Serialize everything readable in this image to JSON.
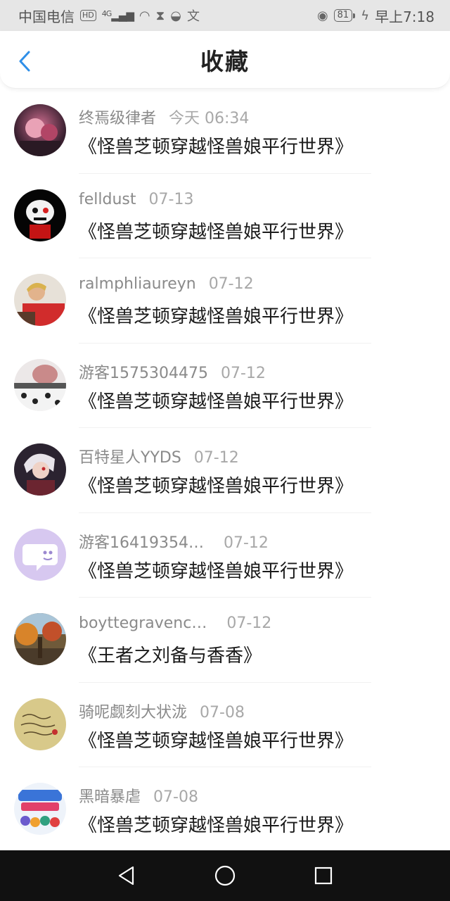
{
  "status_bar": {
    "carrier": "中国电信",
    "hd": "HD",
    "signal": "4G",
    "battery": "81",
    "time": "早上7:18"
  },
  "header": {
    "title": "收藏",
    "back_icon": "chevron-left-icon",
    "accent_color": "#2f8fe8"
  },
  "favorites": [
    {
      "user": "终焉级律者",
      "time": "今天 06:34",
      "book": "《怪兽芝顿穿越怪兽娘平行世界》"
    },
    {
      "user": "felldust",
      "time": "07-13",
      "book": "《怪兽芝顿穿越怪兽娘平行世界》"
    },
    {
      "user": "ralmphliaureyn",
      "time": "07-12",
      "book": "《怪兽芝顿穿越怪兽娘平行世界》"
    },
    {
      "user": "游客1575304475",
      "time": "07-12",
      "book": "《怪兽芝顿穿越怪兽娘平行世界》"
    },
    {
      "user": "百特星人YYDS",
      "time": "07-12",
      "book": "《怪兽芝顿穿越怪兽娘平行世界》"
    },
    {
      "user": "游客16419354…",
      "time": "07-12",
      "book": "《怪兽芝顿穿越怪兽娘平行世界》"
    },
    {
      "user": "boyttegravenc…",
      "time": "07-12",
      "book": "《王者之刘备与香香》"
    },
    {
      "user": "骑呢觑刻大状泷",
      "time": "07-08",
      "book": "《怪兽芝顿穿越怪兽娘平行世界》"
    },
    {
      "user": "黑暗暴虐",
      "time": "07-08",
      "book": "《怪兽芝顿穿越怪兽娘平行世界》"
    }
  ],
  "nav_bar": {
    "back": "triangle-back-icon",
    "home": "circle-home-icon",
    "recent": "square-recent-icon"
  }
}
